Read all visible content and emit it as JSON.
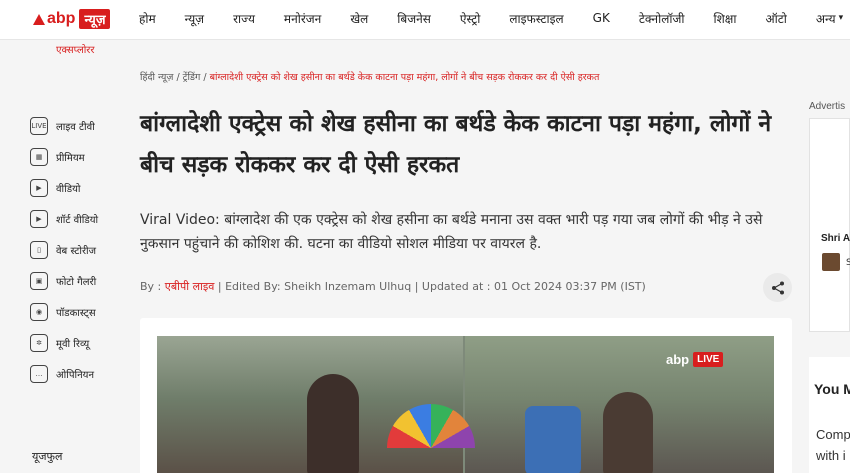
{
  "header": {
    "logo_text": "abp",
    "logo_badge": "न्यूज़",
    "nav": [
      "होम",
      "न्यूज़",
      "राज्य",
      "मनोरंजन",
      "खेल",
      "बिजनेस",
      "ऐस्ट्रो",
      "लाइफस्टाइल",
      "GK",
      "टेक्नोलॉजी",
      "शिक्षा",
      "ऑटो"
    ],
    "more_label": "अन्य",
    "explore_label": "एक्सप्लोरर"
  },
  "sidebar": {
    "items": [
      {
        "label": "लाइव टीवी",
        "icon": "live-tv-icon",
        "glyph": "LIVE"
      },
      {
        "label": "प्रीमियम",
        "icon": "premium-icon",
        "glyph": "▦"
      },
      {
        "label": "वीडियो",
        "icon": "video-icon",
        "glyph": "▶"
      },
      {
        "label": "शॉर्ट वीडियो",
        "icon": "short-video-icon",
        "glyph": "▶"
      },
      {
        "label": "वेब स्टोरीज",
        "icon": "web-stories-icon",
        "glyph": "▯"
      },
      {
        "label": "फोटो गैलरी",
        "icon": "photo-gallery-icon",
        "glyph": "▣"
      },
      {
        "label": "पॉडकास्ट्स",
        "icon": "podcast-icon",
        "glyph": "◉"
      },
      {
        "label": "मूवी रिव्यू",
        "icon": "movie-review-icon",
        "glyph": "✲"
      },
      {
        "label": "ओपिनियन",
        "icon": "opinion-icon",
        "glyph": "…"
      }
    ],
    "useful_label": "यूजफुल"
  },
  "breadcrumb": {
    "items": [
      "हिंदी न्यूज़",
      "ट्रेंडिंग"
    ],
    "separator": "/",
    "current": "बांग्लादेशी एक्ट्रेस को शेख हसीना का बर्थडे केक काटना पड़ा महंगा, लोगों ने बीच सड़क रोककर कर दी ऐसी हरकत"
  },
  "article": {
    "headline": "बांग्लादेशी एक्ट्रेस को शेख हसीना का बर्थडे केक काटना पड़ा महंगा, लोगों ने बीच सड़क रोककर कर दी ऐसी हरकत",
    "summary": "Viral Video: बांग्लादेश की एक एक्ट्रेस को शेख हसीना का बर्थडे मनाना उस वक्त भारी पड़ गया जब लोगों की भीड़ ने उसे नुकसान पहुंचाने की कोशिश की. घटना का वीडियो सोशल मीडिया पर वायरल है.",
    "by_prefix": "By :",
    "author": "एबीपी लाइव",
    "edited_by": "Edited By: Sheikh Inzemam Ulhuq",
    "updated": "Updated at : 01 Oct 2024 03:37 PM (IST)",
    "live_badge": {
      "logo": "abp",
      "label": "LIVE"
    }
  },
  "right_rail": {
    "advert_label": "Advertis",
    "advert_name": "Shri A",
    "advert_sub": "S",
    "widget_title": "You M",
    "widget_line1": "Comp",
    "widget_line2": "with i"
  },
  "colors": {
    "brand": "#d81e1e",
    "text": "#222222",
    "background": "#f5f5f5"
  }
}
